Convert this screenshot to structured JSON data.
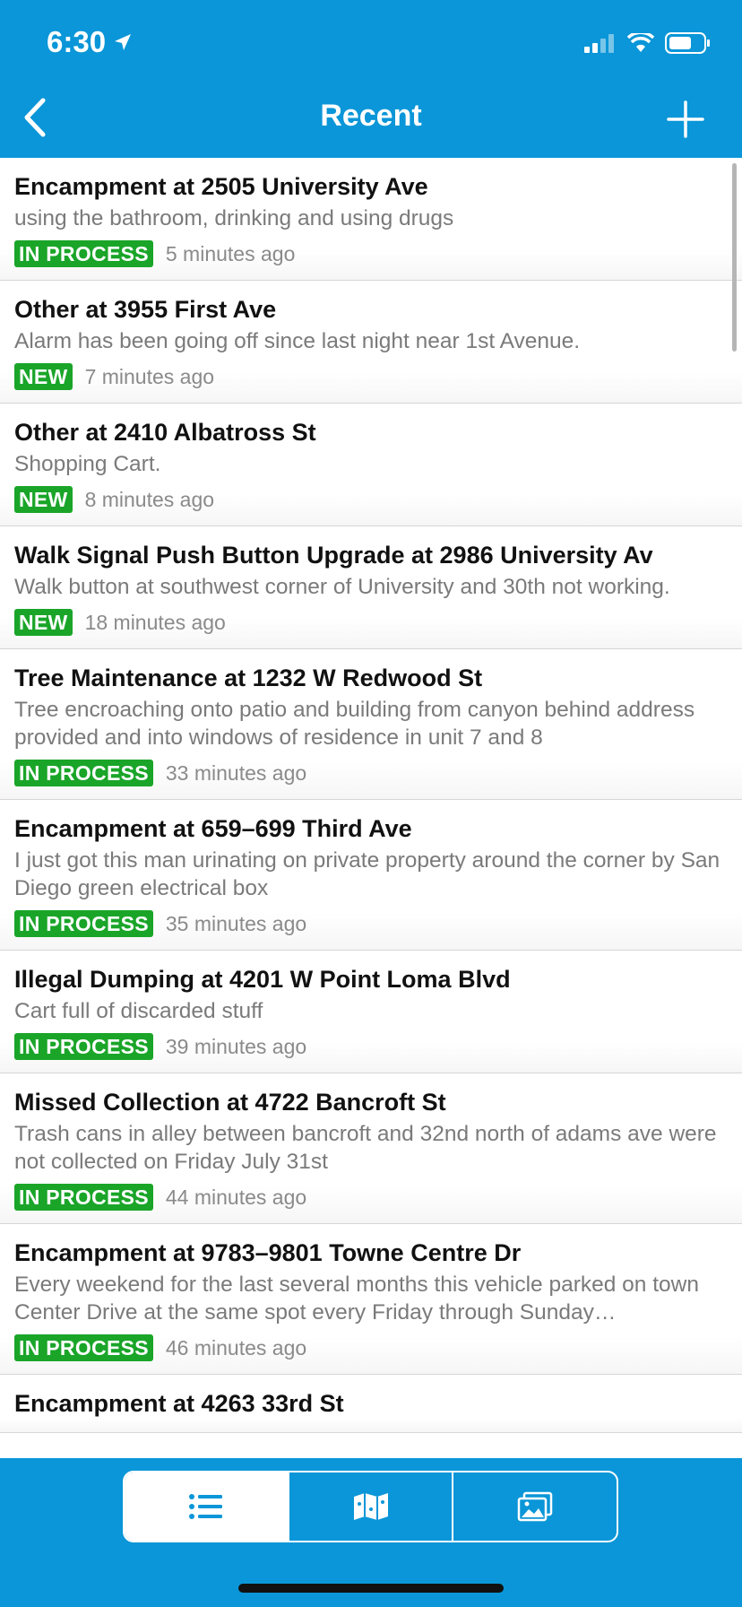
{
  "status_bar": {
    "time": "6:30"
  },
  "nav": {
    "title": "Recent"
  },
  "items": [
    {
      "title": "Encampment at 2505 University Ave",
      "description": "using the bathroom, drinking and using drugs",
      "status": "IN PROCESS",
      "time": "5 minutes ago"
    },
    {
      "title": "Other at 3955 First Ave",
      "description": "Alarm has been going off since last night near 1st Avenue.",
      "status": "NEW",
      "time": "7 minutes ago"
    },
    {
      "title": "Other at 2410 Albatross St",
      "description": "Shopping Cart.",
      "status": "NEW",
      "time": "8 minutes ago"
    },
    {
      "title": "Walk Signal Push Button Upgrade at 2986 University Av",
      "description": "Walk button at southwest corner of University and 30th not working.",
      "status": "NEW",
      "time": "18 minutes ago"
    },
    {
      "title": "Tree Maintenance at 1232 W Redwood St",
      "description": "Tree encroaching onto patio and building from canyon behind address provided and into windows of residence in unit 7 and 8",
      "status": "IN PROCESS",
      "time": "33 minutes ago"
    },
    {
      "title": "Encampment at 659–699 Third Ave",
      "description": "I just got this man urinating on private property around the corner by San Diego green electrical box",
      "status": "IN PROCESS",
      "time": "35 minutes ago"
    },
    {
      "title": "Illegal Dumping at 4201 W Point Loma Blvd",
      "description": "Cart full of discarded stuff",
      "status": "IN PROCESS",
      "time": "39 minutes ago"
    },
    {
      "title": "Missed Collection at 4722 Bancroft St",
      "description": "Trash cans in alley between bancroft and 32nd north of adams ave were not collected on Friday July 31st",
      "status": "IN PROCESS",
      "time": "44 minutes ago"
    },
    {
      "title": "Encampment at 9783–9801 Towne Centre Dr",
      "description": "Every weekend for the last several months this vehicle parked on town Center Drive at the same spot every Friday through Sunday…",
      "status": "IN PROCESS",
      "time": "46 minutes ago"
    },
    {
      "title": "Encampment at 4263 33rd St",
      "description": "",
      "status": "",
      "time": ""
    }
  ],
  "tabbar": {
    "tabs": [
      {
        "icon": "list-icon",
        "active": true
      },
      {
        "icon": "map-icon",
        "active": false
      },
      {
        "icon": "photos-icon",
        "active": false
      }
    ]
  },
  "colors": {
    "header": "#0a96d8",
    "badge": "#1aa529"
  }
}
